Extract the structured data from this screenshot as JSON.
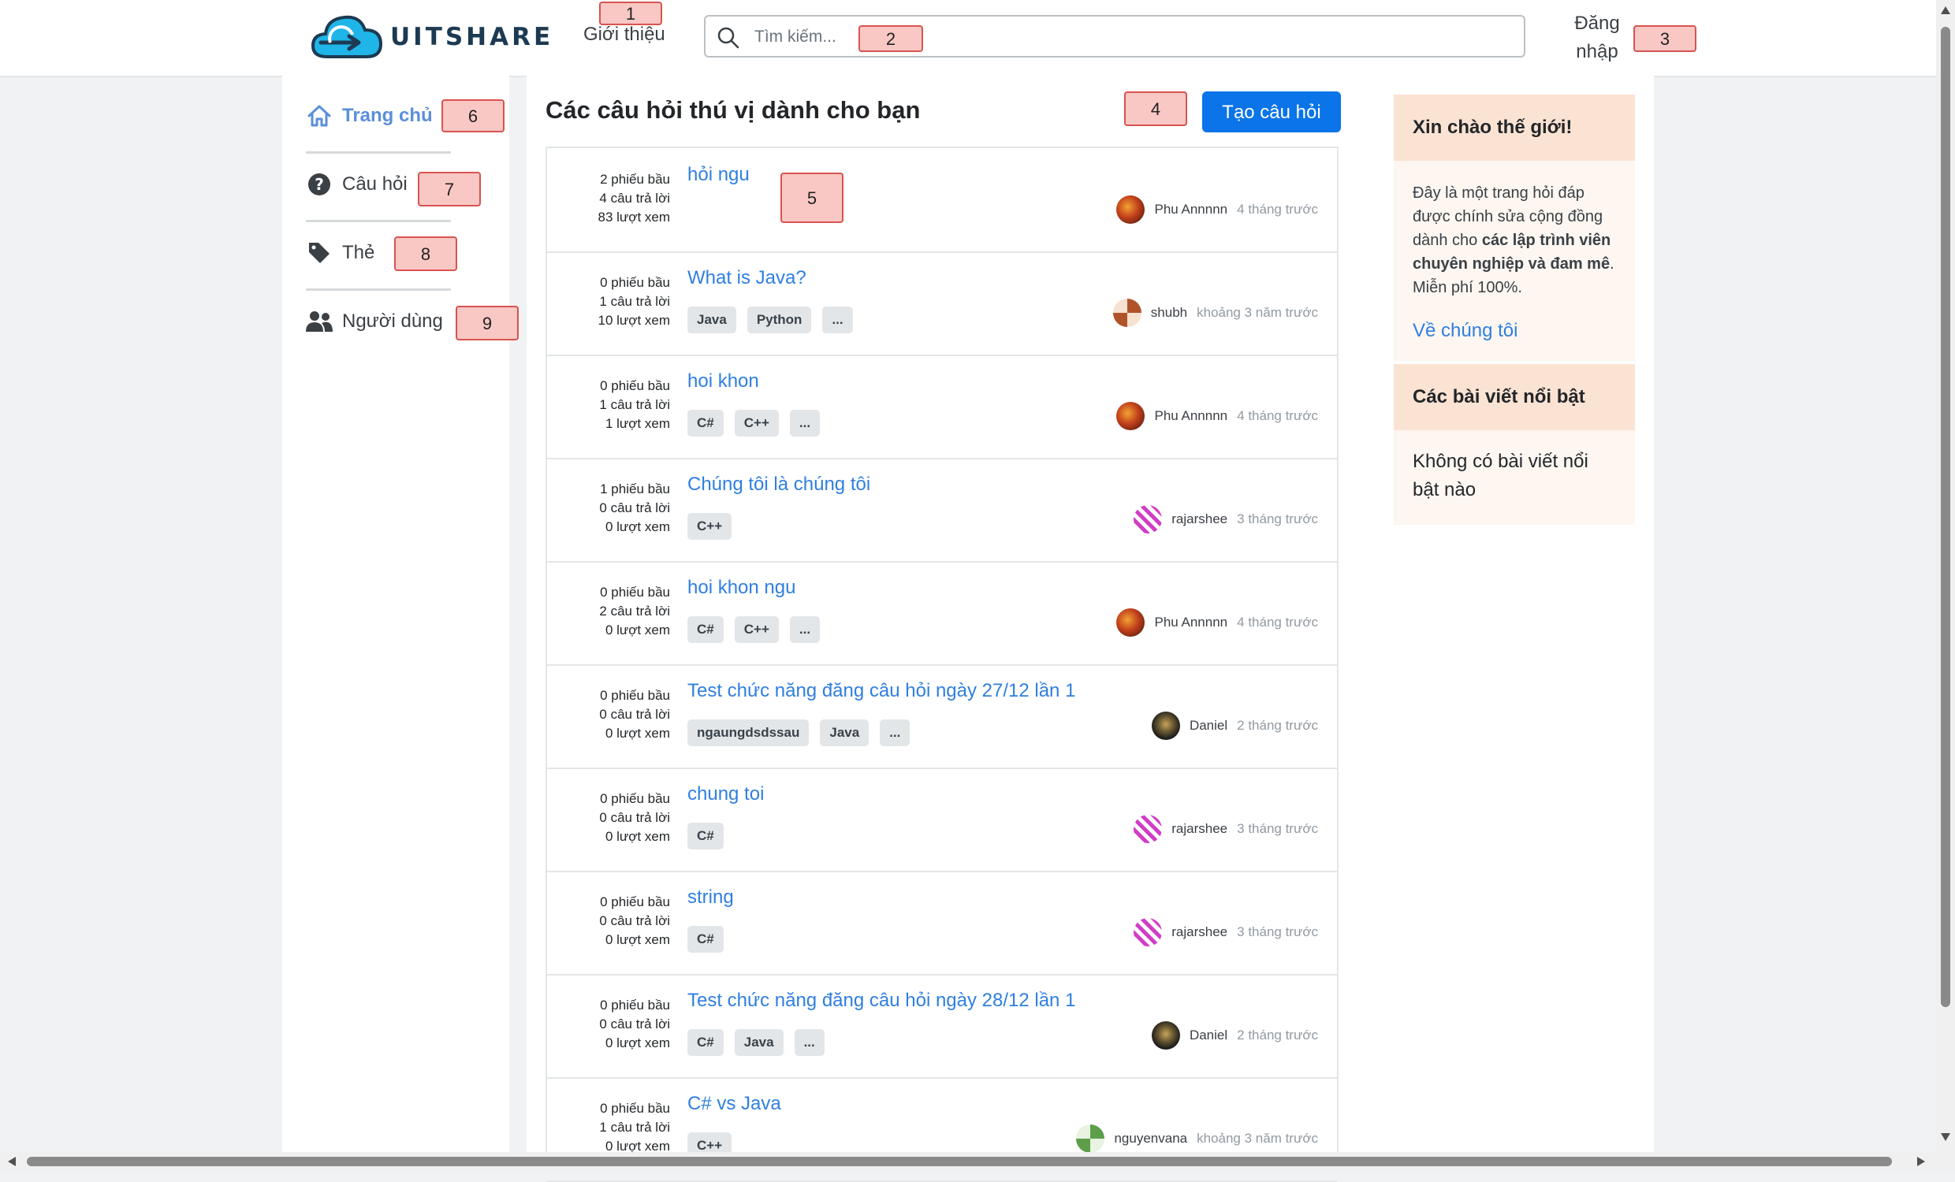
{
  "header": {
    "brand": "UITSHARE",
    "about_label": "Giới thiệu",
    "search_placeholder": "Tìm kiếm...",
    "login_label": "Đăng nhập",
    "search_icon": "search-icon",
    "logo_icon": "cloud-logo-icon"
  },
  "annotations": [
    "1",
    "2",
    "3",
    "4",
    "5",
    "6",
    "7",
    "8",
    "9"
  ],
  "sidebar": {
    "items": [
      {
        "label": "Trang chủ",
        "icon": "home-icon",
        "active": true
      },
      {
        "label": "Câu hỏi",
        "icon": "question-circle-icon"
      },
      {
        "label": "Thẻ",
        "icon": "tag-icon"
      },
      {
        "label": "Người dùng",
        "icon": "users-icon"
      }
    ]
  },
  "main": {
    "title": "Các câu hỏi thú vị dành cho bạn",
    "ask_button": "Tạo câu hỏi",
    "questions": [
      {
        "votes": "2 phiếu bầu",
        "answers": "4 câu trả lời",
        "views": "83 lượt xem",
        "title": "hỏi ngu",
        "tags": [],
        "author": "Phu Annnnn",
        "time": "4 tháng trước"
      },
      {
        "votes": "0 phiếu bầu",
        "answers": "1 câu trả lời",
        "views": "10 lượt xem",
        "title": "What is Java?",
        "tags": [
          "Java",
          "Python",
          "..."
        ],
        "author": "shubh",
        "time": "khoảng 3 năm trước"
      },
      {
        "votes": "0 phiếu bầu",
        "answers": "1 câu trả lời",
        "views": "1 lượt xem",
        "title": "hoi khon",
        "tags": [
          "C#",
          "C++",
          "..."
        ],
        "author": "Phu Annnnn",
        "time": "4 tháng trước"
      },
      {
        "votes": "1 phiếu bầu",
        "answers": "0 câu trả lời",
        "views": "0 lượt xem",
        "title": "Chúng tôi là chúng tôi",
        "tags": [
          "C++"
        ],
        "author": "rajarshee",
        "time": "3 tháng trước"
      },
      {
        "votes": "0 phiếu bầu",
        "answers": "2 câu trả lời",
        "views": "0 lượt xem",
        "title": "hoi khon ngu",
        "tags": [
          "C#",
          "C++",
          "..."
        ],
        "author": "Phu Annnnn",
        "time": "4 tháng trước"
      },
      {
        "votes": "0 phiếu bầu",
        "answers": "0 câu trả lời",
        "views": "0 lượt xem",
        "title": "Test chức năng đăng câu hỏi ngày 27/12 lần 1",
        "tags": [
          "ngaungdsdssau",
          "Java",
          "..."
        ],
        "author": "Daniel",
        "time": "2 tháng trước"
      },
      {
        "votes": "0 phiếu bầu",
        "answers": "0 câu trả lời",
        "views": "0 lượt xem",
        "title": "chung toi",
        "tags": [
          "C#"
        ],
        "author": "rajarshee",
        "time": "3 tháng trước"
      },
      {
        "votes": "0 phiếu bầu",
        "answers": "0 câu trả lời",
        "views": "0 lượt xem",
        "title": "string",
        "tags": [
          "C#"
        ],
        "author": "rajarshee",
        "time": "3 tháng trước"
      },
      {
        "votes": "0 phiếu bầu",
        "answers": "0 câu trả lời",
        "views": "0 lượt xem",
        "title": "Test chức năng đăng câu hỏi ngày 28/12 lần 1",
        "tags": [
          "C#",
          "Java",
          "..."
        ],
        "author": "Daniel",
        "time": "2 tháng trước"
      },
      {
        "votes": "0 phiếu bầu",
        "answers": "1 câu trả lời",
        "views": "0 lượt xem",
        "title": "C# vs Java",
        "tags": [
          "C++"
        ],
        "author": "nguyenvana",
        "time": "khoảng 3 năm trước"
      }
    ]
  },
  "aside": {
    "welcome_title": "Xin chào thế giới!",
    "welcome_text_1": "Đây là một trang hỏi đáp được chính sửa cộng đồng dành cho ",
    "welcome_text_bold": "các lập trình viên chuyên nghiệp và đam mê",
    "welcome_text_2": ". Miễn phí 100%.",
    "about_link": "Về chúng tôi",
    "featured_title": "Các bài viết nổi bật",
    "featured_empty": "Không có bài viết nổi bật nào"
  },
  "colors": {
    "accent": "#0a74e8",
    "link": "#2f7fe0",
    "active_nav": "#5b8fd9",
    "widget_header": "#fbe3d3",
    "widget_body": "#fdf6f1"
  }
}
